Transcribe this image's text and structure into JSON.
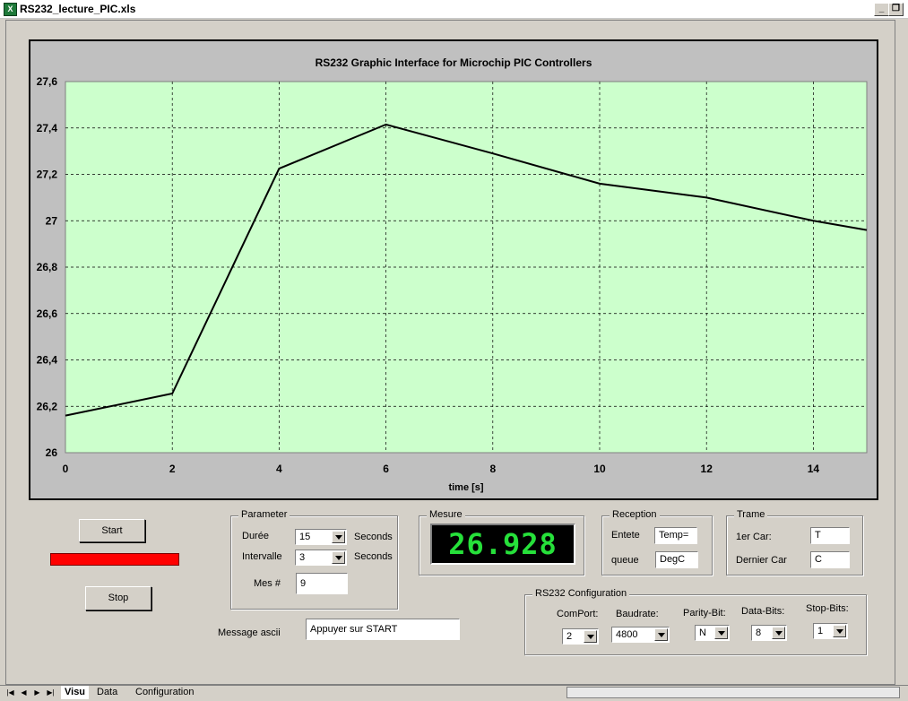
{
  "window": {
    "title": "RS232_lecture_PIC.xls",
    "app_icon": "excel-icon"
  },
  "chart_data": {
    "type": "line",
    "title": "RS232 Graphic Interface for Microchip PIC Controllers",
    "xlabel": "time [s]",
    "ylabel": "",
    "xlim": [
      0,
      15
    ],
    "ylim": [
      26,
      27.6
    ],
    "x_ticks": [
      "0",
      "2",
      "4",
      "6",
      "8",
      "10",
      "12",
      "14"
    ],
    "y_ticks": [
      "26",
      "26,2",
      "26,4",
      "26,6",
      "26,8",
      "27",
      "27,2",
      "27,4",
      "27,6"
    ],
    "grid": true,
    "plot_background": "#ccffcc",
    "series": [
      {
        "x": [
          0,
          2,
          4,
          6,
          8,
          10,
          12,
          14,
          15
        ],
        "y": [
          26.16,
          26.255,
          27.225,
          27.415,
          27.29,
          27.16,
          27.1,
          27.0,
          26.96
        ]
      }
    ]
  },
  "controls": {
    "start_label": "Start",
    "stop_label": "Stop",
    "status_bar_color": "#ff0000",
    "message_label": "Message ascii",
    "message_value": "Appuyer sur START"
  },
  "parameter": {
    "title": "Parameter",
    "duree_label": "Durée",
    "duree_value": "15",
    "duree_unit": "Seconds",
    "intervalle_label": "Intervalle",
    "intervalle_value": "3",
    "intervalle_unit": "Seconds",
    "mes_label": "Mes #",
    "mes_value": "9"
  },
  "mesure": {
    "title": "Mesure",
    "value": "26.928",
    "color": "#26e03a"
  },
  "reception": {
    "title": "Reception",
    "entete_label": "Entete",
    "entete_value": "Temp=",
    "queue_label": "queue",
    "queue_value": "DegC"
  },
  "trame": {
    "title": "Trame",
    "first_label": "1er Car:",
    "first_value": "T",
    "last_label": "Dernier Car",
    "last_value": "C"
  },
  "rs232": {
    "title": "RS232 Configuration",
    "comport_label": "ComPort:",
    "comport_value": "2",
    "baud_label": "Baudrate:",
    "baud_value": "4800",
    "parity_label": "Parity-Bit:",
    "parity_value": "N",
    "databits_label": "Data-Bits:",
    "databits_value": "8",
    "stopbits_label": "Stop-Bits:",
    "stopbits_value": "1"
  },
  "sheets": {
    "tabs": [
      "Visu",
      "Data",
      "Configuration"
    ],
    "active": "Visu"
  }
}
